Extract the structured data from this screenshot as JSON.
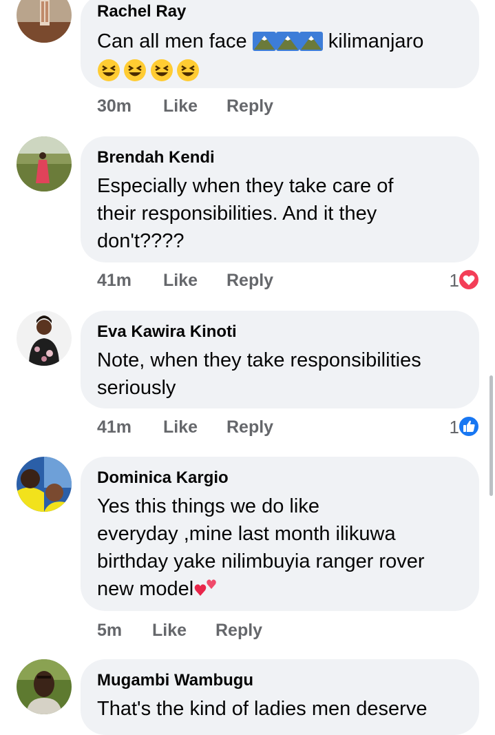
{
  "comments": [
    {
      "author": "Rachel Ray",
      "text_before": "Can all men face",
      "text_after": "kilimanjaro",
      "inline_emoji": [
        "mountain-emoji",
        "mountain-emoji",
        "mountain-emoji"
      ],
      "trailing_emoji": [
        "grinning-squinting-face-emoji",
        "grinning-squinting-face-emoji",
        "grinning-squinting-face-emoji",
        "grinning-squinting-face-emoji"
      ],
      "time": "30m",
      "like_label": "Like",
      "reply_label": "Reply"
    },
    {
      "author": "Brendah Kendi",
      "lines": [
        "Especially when they take care of",
        "their responsibilities. And it they",
        "don't????"
      ],
      "time": "41m",
      "like_label": "Like",
      "reply_label": "Reply",
      "reaction_count": "1",
      "reaction_icon": "heart-reaction-icon",
      "reaction_color": "#f33e58"
    },
    {
      "author": "Eva Kawira Kinoti",
      "lines": [
        "Note, when they take responsibilities",
        "seriously"
      ],
      "time": "41m",
      "like_label": "Like",
      "reply_label": "Reply",
      "reaction_count": "1",
      "reaction_icon": "thumbs-up-reaction-icon",
      "reaction_color": "#1877f2"
    },
    {
      "author": "Dominica Kargio",
      "lines": [
        "Yes this things we do like",
        "everyday ,mine last month ilikuwa",
        "birthday yake nilimbuyia ranger rover",
        "new model"
      ],
      "trailing_emoji": "two-hearts-emoji",
      "time": "5m",
      "like_label": "Like",
      "reply_label": "Reply"
    },
    {
      "author": "Mugambi Wambugu",
      "lines": [
        "That's the kind of ladies men deserve"
      ]
    }
  ],
  "colors": {
    "bubble": "#f0f2f5",
    "secondary_text": "#65676b",
    "primary_text": "#050505"
  }
}
